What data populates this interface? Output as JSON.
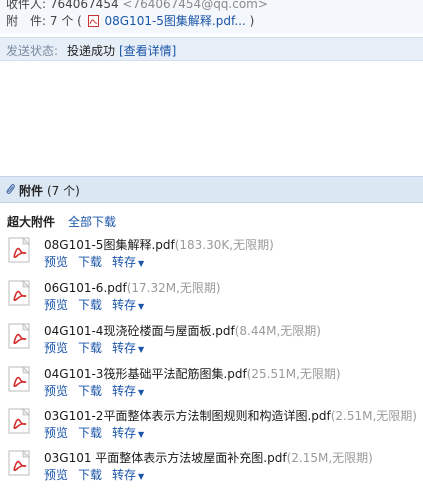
{
  "header": {
    "from_label": "收件人:",
    "from_number": "764067454",
    "from_addr": "<764067454@qq.com>",
    "att_label": "附　件:",
    "att_count": "7 个 (",
    "att_first": "08G101-5图集解释.pdf...",
    "att_close": ")"
  },
  "status": {
    "label": "发送状态:",
    "value": "投递成功",
    "detail": "[查看详情]"
  },
  "attachments": {
    "title": "附件",
    "count": "(7 个)",
    "big_title": "超大附件",
    "download_all": "全部下载",
    "actions": {
      "preview": "预览",
      "download": "下载",
      "forward": "转存"
    },
    "files": [
      {
        "name": "08G101-5图集解释.pdf",
        "meta": "(183.30K,无限期)"
      },
      {
        "name": "06G101-6.pdf",
        "meta": "(17.32M,无限期)"
      },
      {
        "name": "04G101-4现浇砼楼面与屋面板.pdf",
        "meta": "(8.44M,无限期)"
      },
      {
        "name": "04G101-3筏形基础平法配筋图集.pdf",
        "meta": "(25.51M,无限期)"
      },
      {
        "name": "03G101-2平面整体表示方法制图规则和构造详图.pdf",
        "meta": "(2.51M,无限期)"
      },
      {
        "name": "03G101 平面整体表示方法坡屋面补充图.pdf",
        "meta": "(2.15M,无限期)"
      }
    ]
  },
  "colors": {
    "link": "#1a55a8",
    "status_bg": "#e6eef7",
    "attach_bar_bg": "#dce7f4",
    "pdf_red": "#d32f2f"
  },
  "icons": {
    "attachment": "paperclip-icon",
    "file": "pdf-file-icon",
    "dropdown": "chevron-down-icon"
  }
}
